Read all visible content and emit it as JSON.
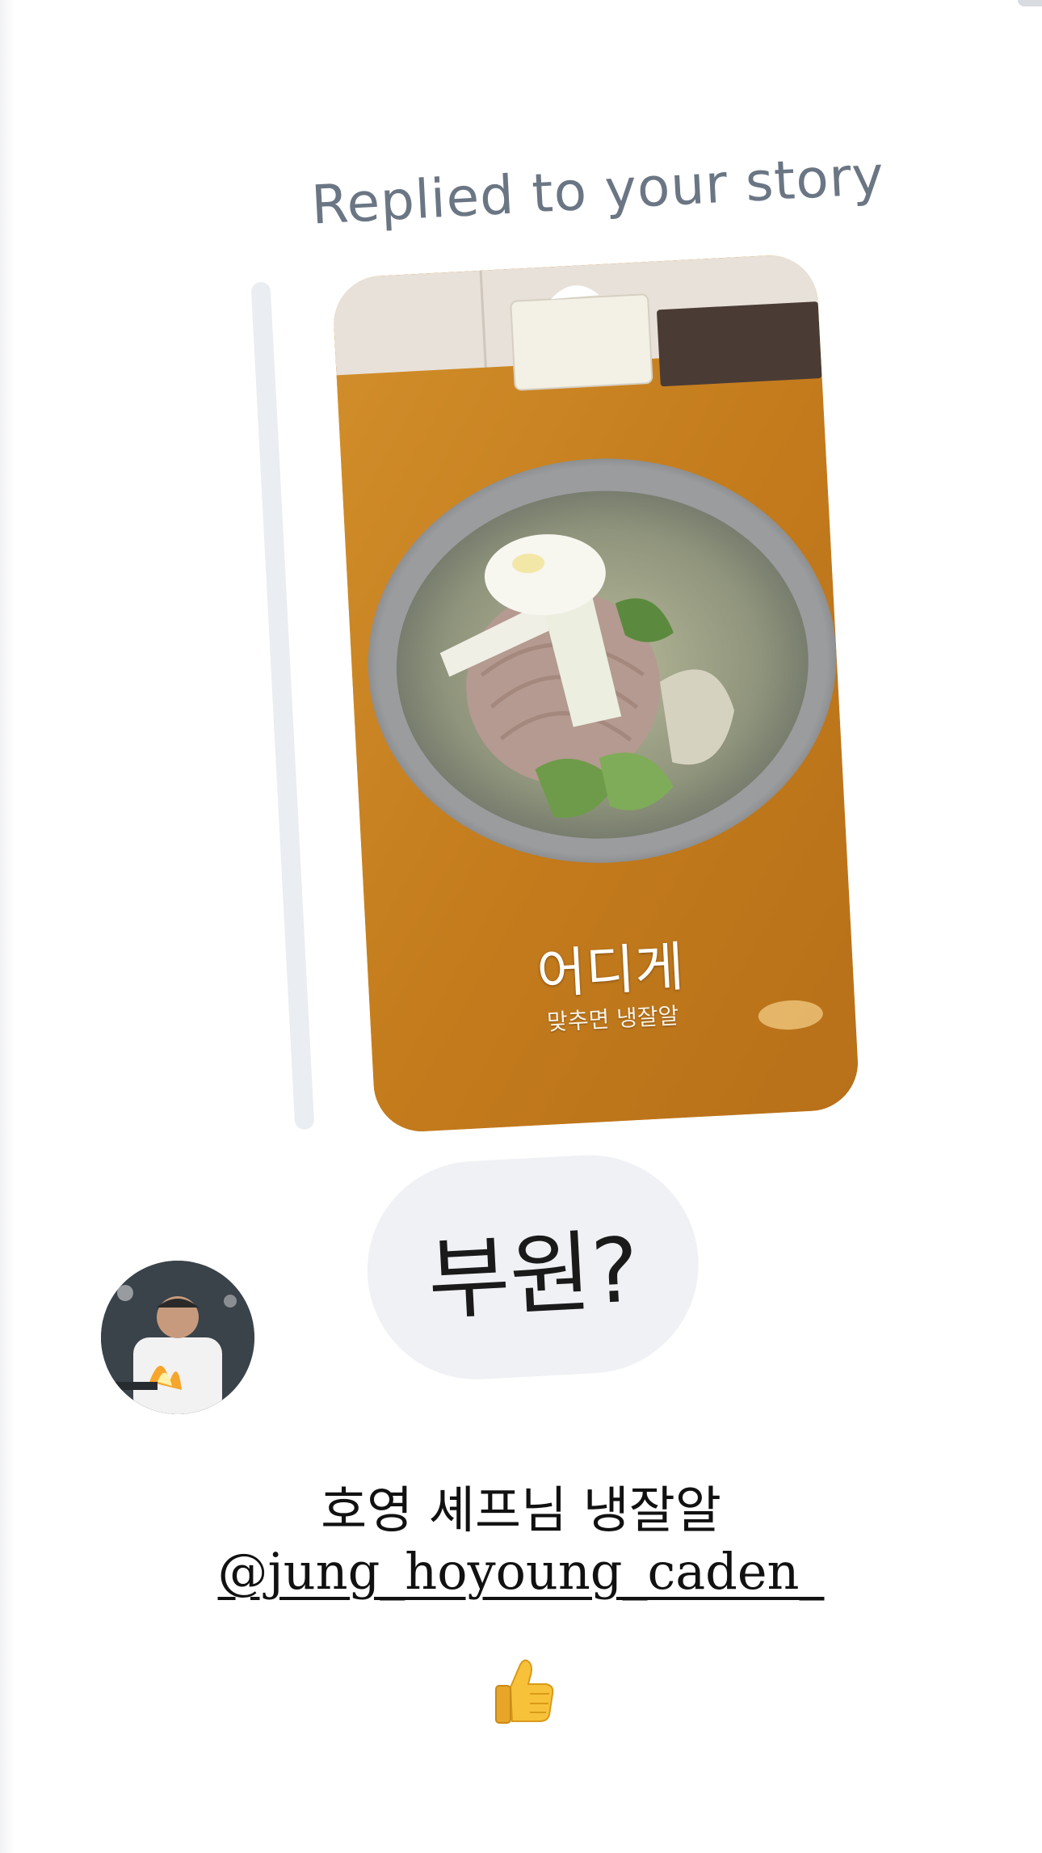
{
  "reply": {
    "header": "Replied to your story",
    "story": {
      "overlay_title": "어디게",
      "overlay_subtitle": "맞추면 냉잘알"
    },
    "message": "부원?"
  },
  "sender": {
    "avatar_icon": "chef-flame-avatar"
  },
  "caption": {
    "line1": "호영 셰프님 냉잘알",
    "mention": "@jung_hoyoung_caden_",
    "emoji": "thumbs-up-icon"
  },
  "colors": {
    "header_text": "#6b7684",
    "quote_bar": "#eaedf1",
    "bubble_bg": "#eff1f4",
    "table_wood": "#c88322"
  }
}
